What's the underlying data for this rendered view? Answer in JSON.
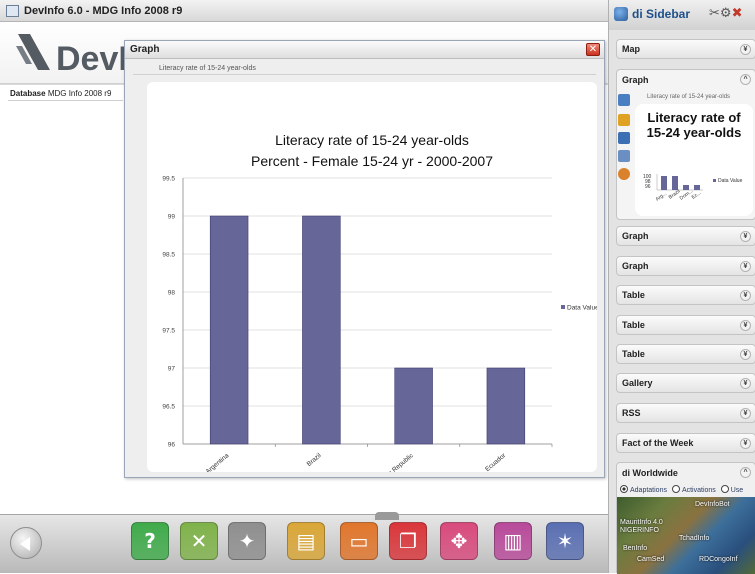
{
  "window": {
    "title": "DevInfo 6.0 - MDG Info 2008 r9",
    "logo_text": "DevI"
  },
  "database": {
    "label": "Database",
    "value": "MDG Info 2008 r9"
  },
  "dialog": {
    "title": "Graph",
    "close_label": "✕",
    "subtitle": "Literacy rate of 15-24 year-olds"
  },
  "chart_data": {
    "type": "bar",
    "title": "Literacy rate of 15-24 year-olds",
    "subtitle": "Percent - Female 15-24 yr - 2000-2007",
    "categories": [
      "Argentina",
      "Brazil",
      "Dominican Republic",
      "Ecuador"
    ],
    "series": [
      {
        "name": "Data Value",
        "values": [
          99,
          99,
          97,
          97
        ],
        "color": "#666699"
      }
    ],
    "ylim": [
      96,
      99.5
    ],
    "yticks": [
      "96",
      "96.5",
      "97",
      "97.5",
      "98",
      "98.5",
      "99",
      "99.5"
    ],
    "grid": true,
    "legend": "right"
  },
  "sidebar": {
    "title": "di Sidebar",
    "tools_icons": [
      "scissors-icon",
      "gear-icon",
      "close-icon"
    ],
    "panels": [
      {
        "label": "Map",
        "state": "collapsed"
      },
      {
        "label": "Graph",
        "state": "collapsed"
      },
      {
        "label": "Graph",
        "state": "collapsed"
      },
      {
        "label": "Table",
        "state": "collapsed"
      },
      {
        "label": "Table",
        "state": "collapsed"
      },
      {
        "label": "Table",
        "state": "collapsed"
      },
      {
        "label": "Gallery",
        "state": "collapsed"
      },
      {
        "label": "RSS",
        "state": "collapsed"
      },
      {
        "label": "Fact of the Week",
        "state": "collapsed"
      }
    ],
    "chev_down": "¥",
    "chev_up": "^",
    "expanded": {
      "label": "Graph",
      "subtitle": "Literacy rate of 15-24 year-olds",
      "thumb_title": "Literacy rate of 15-24 year-olds",
      "thumb_legend": "Data Value",
      "thumb_yticks": [
        "100",
        "98",
        "96"
      ],
      "thumb_categories": [
        "Arg...",
        "Brazil",
        "Dom...",
        "Ec..."
      ]
    },
    "worldwide": {
      "label": "di Worldwide",
      "radios": [
        {
          "label": "Adaptations",
          "selected": true
        },
        {
          "label": "Activations",
          "selected": false
        },
        {
          "label": "Use",
          "selected": false
        }
      ],
      "map_labels": [
        "DevInfoBot",
        "MauritInfo 4.0",
        "NIGERINFO",
        "TchadInfo",
        "BenInfo",
        "CamSed",
        "RDCongoInf"
      ]
    },
    "vertical_icons": [
      "chart-type-icon",
      "bar-chart-icon",
      "column-icon",
      "data-icon",
      "globe-icon"
    ]
  },
  "toolbar": {
    "back_icon": "back-arrow-icon",
    "buttons": [
      {
        "icon": "help-icon",
        "glyph": "?",
        "color": "#3faa4a"
      },
      {
        "icon": "tools-icon",
        "glyph": "✕",
        "color": "#7fb24a"
      },
      {
        "icon": "wizard-icon",
        "glyph": "✦",
        "color": "#8e8e8e"
      },
      {
        "icon": "gallery-icon",
        "glyph": "▤",
        "color": "#d9a637"
      },
      {
        "icon": "presentation-icon",
        "glyph": "▭",
        "color": "#e0752b"
      },
      {
        "icon": "pages-icon",
        "glyph": "❐",
        "color": "#d9353a"
      },
      {
        "icon": "move-icon",
        "glyph": "✥",
        "color": "#d84a7c"
      },
      {
        "icon": "panels-icon",
        "glyph": "▥",
        "color": "#b84a9a"
      },
      {
        "icon": "network-icon",
        "glyph": "✶",
        "color": "#5a6fb2"
      }
    ]
  }
}
